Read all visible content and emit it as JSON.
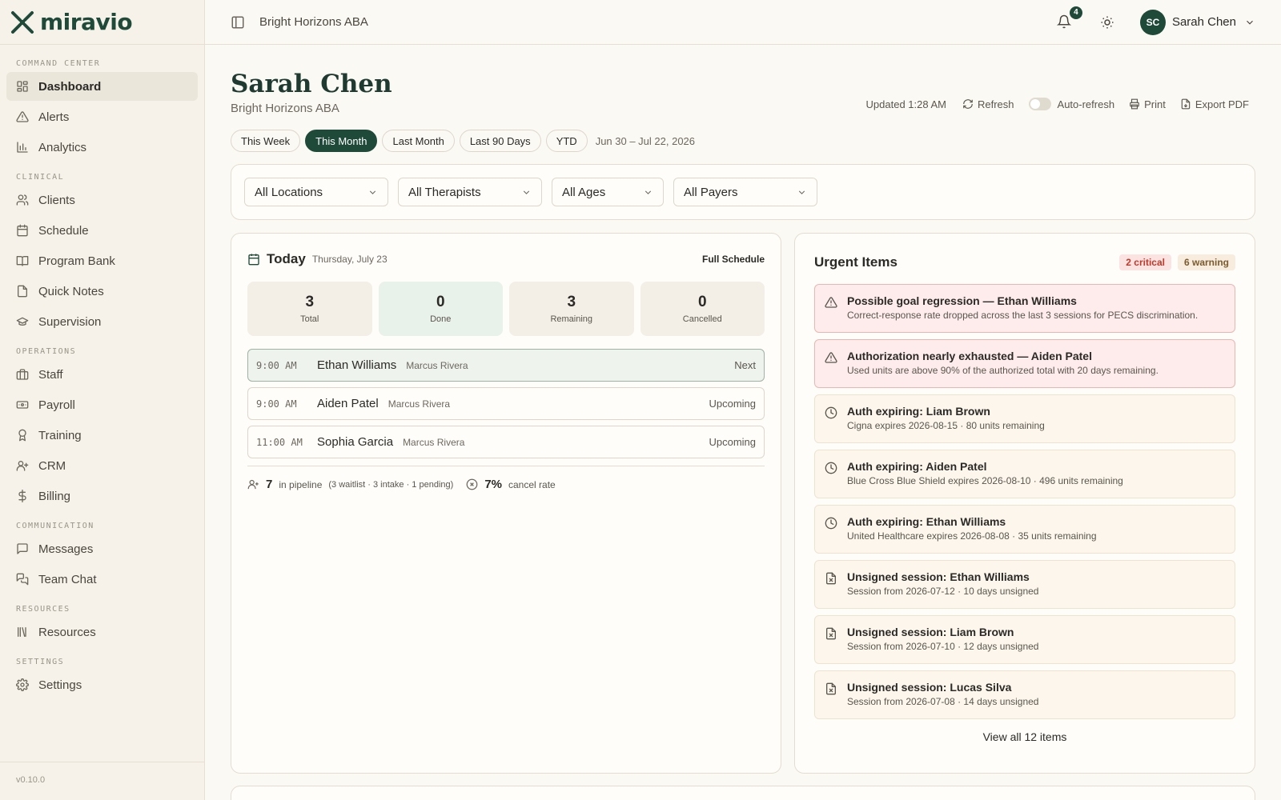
{
  "brand": {
    "logo_text": "miravio"
  },
  "sidebar": {
    "sections": [
      {
        "title": "COMMAND CENTER",
        "items": [
          {
            "label": "Dashboard",
            "icon": "dashboard-icon",
            "active": true
          },
          {
            "label": "Alerts",
            "icon": "alert-triangle-icon"
          },
          {
            "label": "Analytics",
            "icon": "bar-chart-icon"
          }
        ]
      },
      {
        "title": "CLINICAL",
        "items": [
          {
            "label": "Clients",
            "icon": "users-icon"
          },
          {
            "label": "Schedule",
            "icon": "calendar-icon"
          },
          {
            "label": "Program Bank",
            "icon": "book-icon"
          },
          {
            "label": "Quick Notes",
            "icon": "file-icon"
          },
          {
            "label": "Supervision",
            "icon": "graduation-cap-icon"
          }
        ]
      },
      {
        "title": "OPERATIONS",
        "items": [
          {
            "label": "Staff",
            "icon": "briefcase-icon"
          },
          {
            "label": "Payroll",
            "icon": "banknote-icon"
          },
          {
            "label": "Training",
            "icon": "award-icon"
          },
          {
            "label": "CRM",
            "icon": "user-plus-icon"
          },
          {
            "label": "Billing",
            "icon": "dollar-icon"
          }
        ]
      },
      {
        "title": "COMMUNICATION",
        "items": [
          {
            "label": "Messages",
            "icon": "message-square-icon"
          },
          {
            "label": "Team Chat",
            "icon": "messages-icon"
          }
        ]
      },
      {
        "title": "RESOURCES",
        "items": [
          {
            "label": "Resources",
            "icon": "library-icon"
          }
        ]
      },
      {
        "title": "SETTINGS",
        "items": [
          {
            "label": "Settings",
            "icon": "gear-icon"
          }
        ]
      }
    ],
    "version": "v0.10.0"
  },
  "topbar": {
    "org_name": "Bright Horizons ABA",
    "notifications_count": "4",
    "user_initials": "SC",
    "user_name": "Sarah Chen"
  },
  "header": {
    "title": "Sarah Chen",
    "subtitle": "Bright Horizons ABA",
    "updated": "Updated 1:28 AM",
    "refresh_label": "Refresh",
    "auto_refresh_label": "Auto-refresh",
    "auto_refresh_on": false,
    "print_label": "Print",
    "export_label": "Export PDF"
  },
  "periods": {
    "options": [
      "This Week",
      "This Month",
      "Last Month",
      "Last 90 Days",
      "YTD"
    ],
    "selected": "This Month",
    "date_range": "Jun 30 – Jul 22, 2026"
  },
  "filters": {
    "location": "All Locations",
    "therapist": "All Therapists",
    "age": "All Ages",
    "payer": "All Payers"
  },
  "today": {
    "title": "Today",
    "date": "Thursday, July 23",
    "full_schedule_label": "Full Schedule",
    "stats": [
      {
        "value": "3",
        "label": "Total"
      },
      {
        "value": "0",
        "label": "Done"
      },
      {
        "value": "3",
        "label": "Remaining"
      },
      {
        "value": "0",
        "label": "Cancelled"
      }
    ],
    "sessions": [
      {
        "time": "9:00 AM",
        "client": "Ethan Williams",
        "therapist": "Marcus Rivera",
        "status": "Next"
      },
      {
        "time": "9:00 AM",
        "client": "Aiden Patel",
        "therapist": "Marcus Rivera",
        "status": "Upcoming"
      },
      {
        "time": "11:00 AM",
        "client": "Sophia Garcia",
        "therapist": "Marcus Rivera",
        "status": "Upcoming"
      }
    ],
    "pipeline": {
      "count": "7",
      "label": "in pipeline",
      "breakdown": "(3 waitlist · 3 intake · 1 pending)",
      "cancel_rate": "7%",
      "cancel_label": "cancel rate"
    }
  },
  "urgent": {
    "title": "Urgent Items",
    "critical_badge": "2 critical",
    "warning_badge": "6 warning",
    "items": [
      {
        "severity": "critical",
        "icon": "alert-triangle-icon",
        "title": "Possible goal regression — Ethan Williams",
        "desc": "Correct-response rate dropped across the last 3 sessions for PECS discrimination."
      },
      {
        "severity": "critical",
        "icon": "alert-triangle-icon",
        "title": "Authorization nearly exhausted — Aiden Patel",
        "desc": "Used units are above 90% of the authorized total with 20 days remaining."
      },
      {
        "severity": "warning",
        "icon": "clock-icon",
        "title": "Auth expiring: Liam Brown",
        "desc": "Cigna expires 2026-08-15 · 80 units remaining"
      },
      {
        "severity": "warning",
        "icon": "clock-icon",
        "title": "Auth expiring: Aiden Patel",
        "desc": "Blue Cross Blue Shield expires 2026-08-10 · 496 units remaining"
      },
      {
        "severity": "warning",
        "icon": "clock-icon",
        "title": "Auth expiring: Ethan Williams",
        "desc": "United Healthcare expires 2026-08-08 · 35 units remaining"
      },
      {
        "severity": "warning",
        "icon": "file-x-icon",
        "title": "Unsigned session: Ethan Williams",
        "desc": "Session from 2026-07-12 · 10 days unsigned"
      },
      {
        "severity": "warning",
        "icon": "file-x-icon",
        "title": "Unsigned session: Liam Brown",
        "desc": "Session from 2026-07-10 · 12 days unsigned"
      },
      {
        "severity": "warning",
        "icon": "file-x-icon",
        "title": "Unsigned session: Lucas Silva",
        "desc": "Session from 2026-07-08 · 14 days unsigned"
      }
    ],
    "view_all_label": "View all 12 items"
  },
  "colors": {
    "brand": "#1f4a3a",
    "critical": "#c0392b",
    "background": "#fbf9f4"
  }
}
